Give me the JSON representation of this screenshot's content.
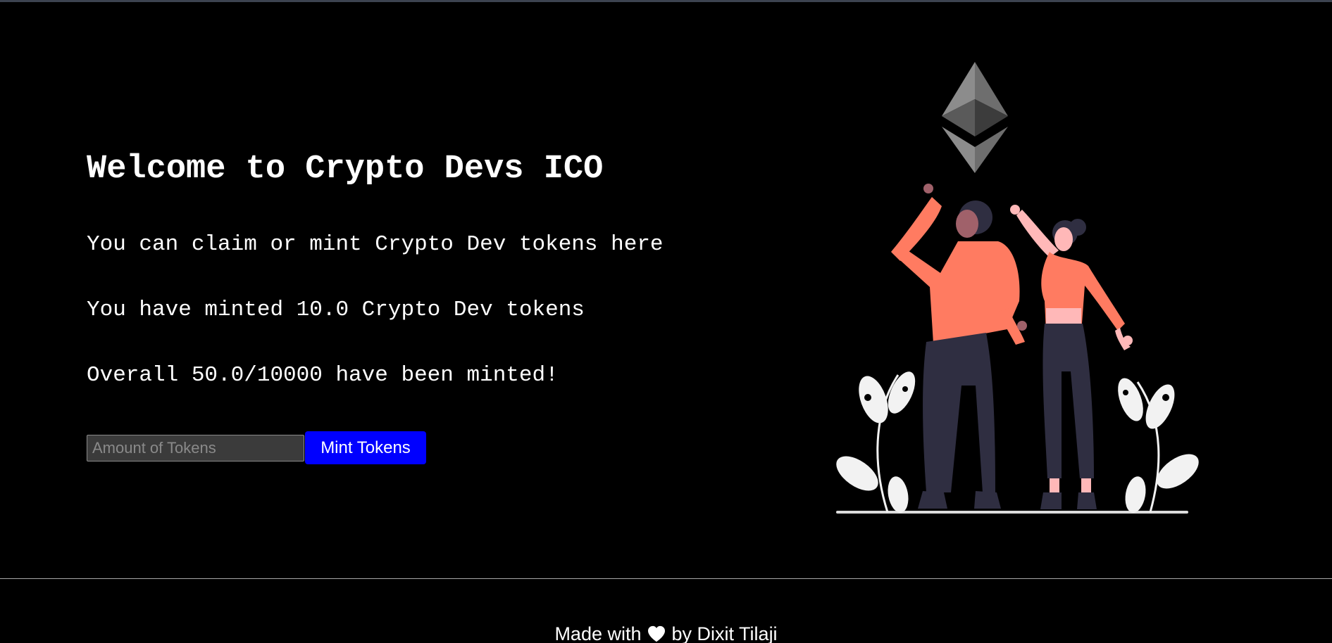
{
  "main": {
    "title": "Welcome to Crypto Devs ICO",
    "description_lines": [
      "You can claim or mint Crypto Dev tokens here",
      "You have minted 10.0 Crypto Dev tokens",
      "Overall 50.0/10000 have been minted!"
    ],
    "mint_form": {
      "input_placeholder": "Amount of Tokens",
      "input_value": "",
      "button_label": "Mint Tokens"
    },
    "illustration": {
      "icon": "ethereum-logo-icon",
      "description_icon": "people-cheering-illustration"
    }
  },
  "footer": {
    "text_before": "Made with",
    "icon": "heart-icon",
    "text_after": "by Dixit Tilaji"
  },
  "colors": {
    "background": "#000000",
    "text": "#ffffff",
    "button": "#0000ff",
    "input_background": "#3b3b3b",
    "figure_accent": "#ff7b61",
    "figure_dark": "#2f2e41",
    "plant": "#f2f2f2"
  }
}
